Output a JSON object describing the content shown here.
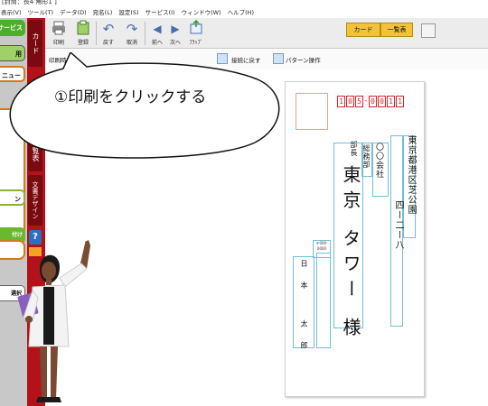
{
  "window": {
    "title": "[封筒：長4 角形1 ]"
  },
  "menu": {
    "items": [
      "表示(V)",
      "ツール(T)",
      "データ(D)",
      "宛名(L)",
      "設定(S)",
      "サービス(I)",
      "ウィンドウ(W)",
      "ヘルプ(H)"
    ]
  },
  "sidebar": {
    "service_label": "サービス",
    "btn2_label": "用",
    "btn3_label": "ニュー",
    "btn4_label": "ン",
    "btn5_label": "付け",
    "btn6_label": "選択",
    "tabs": [
      "カード",
      "覧表",
      "文書デザイン"
    ],
    "help_glyph": "?"
  },
  "toolbar": {
    "print_label": "印刷",
    "register_label": "登録",
    "undo_label": "戻す",
    "cancel_label": "取消",
    "prev_label": "前へ",
    "next_label": "次へ",
    "flip_label": "ﾌﾗｯﾌﾟ",
    "card_mode_label": "カード",
    "list_mode_label": "一覧表"
  },
  "subbar": {
    "print_time_label": "印刷時の",
    "return_pos_label": "接続に戻す",
    "pattern_label": "パターン操作"
  },
  "callout": {
    "text": "①印刷をクリックする"
  },
  "postcard": {
    "zip": [
      "1",
      "0",
      "5",
      "0",
      "0",
      "1",
      "1"
    ],
    "address_line1": "東京都港区芝公園",
    "address_line2": "四ー二ー八",
    "company": "〇〇会社",
    "department": "総務部",
    "title": "部長",
    "recipient": "東京 タワー 様",
    "sender_zip_label": "〒000-0000",
    "sender_name": "日本 太郎"
  },
  "colors": {
    "sidebar_red": "#b3121b",
    "service_green": "#4caf2a",
    "mode_yellow": "#f2c33a",
    "zip_red": "#dd2222",
    "guide_blue": "#6fc0d6"
  }
}
